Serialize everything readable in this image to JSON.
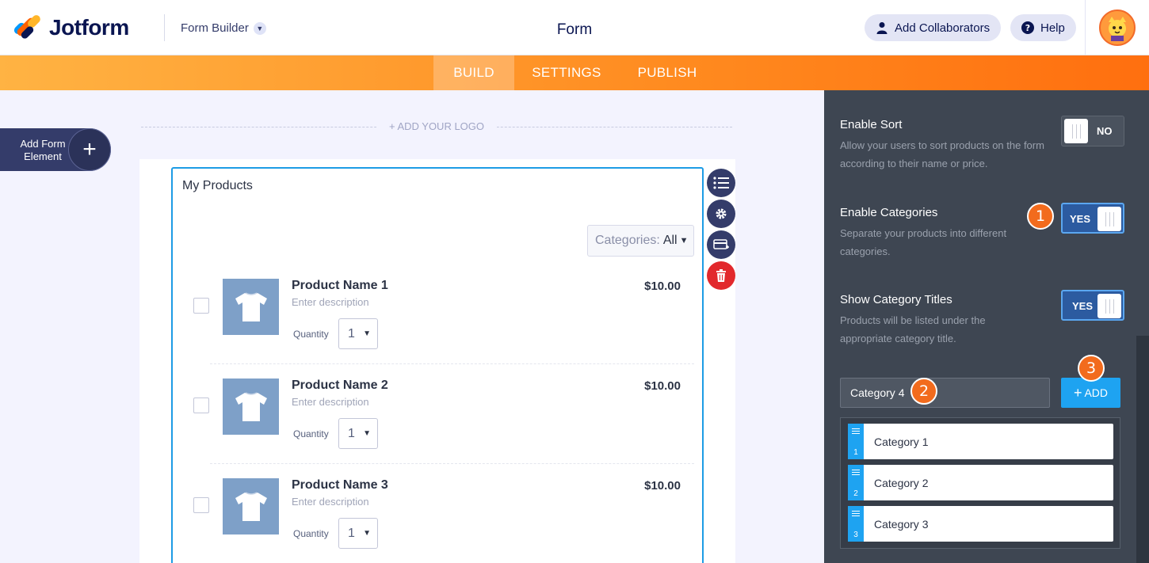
{
  "header": {
    "logo_text": "Jotform",
    "builder_menu": "Form Builder",
    "title": "Form",
    "collab_label": "Add Collaborators",
    "help_label": "Help"
  },
  "tabs": [
    {
      "label": "BUILD",
      "active": true
    },
    {
      "label": "SETTINGS",
      "active": false
    },
    {
      "label": "PUBLISH",
      "active": false
    }
  ],
  "left": {
    "add_element_label": "Add Form Element",
    "add_logo_label": "+ ADD YOUR LOGO"
  },
  "product_list": {
    "title": "My Products",
    "categories_label": "Categories:",
    "categories_value": "All",
    "products": [
      {
        "name": "Product Name 1",
        "description": "Enter description",
        "price": "$10.00",
        "quantity_label": "Quantity",
        "quantity": "1"
      },
      {
        "name": "Product Name 2",
        "description": "Enter description",
        "price": "$10.00",
        "quantity_label": "Quantity",
        "quantity": "1"
      },
      {
        "name": "Product Name 3",
        "description": "Enter description",
        "price": "$10.00",
        "quantity_label": "Quantity",
        "quantity": "1"
      }
    ]
  },
  "panel": {
    "enable_sort": {
      "title": "Enable Sort",
      "description": "Allow your users to sort products on the form according to their name or price.",
      "toggle": "NO"
    },
    "enable_categories": {
      "title": "Enable Categories",
      "description": "Separate your products into different categories.",
      "toggle": "YES"
    },
    "show_category_titles": {
      "title": "Show Category Titles",
      "description": "Products will be listed under the appropriate category title.",
      "toggle": "YES"
    },
    "category_input_value": "Category 4",
    "add_button_label": "ADD",
    "categories": [
      {
        "label": "Category 1",
        "index": "1"
      },
      {
        "label": "Category 2",
        "index": "2"
      },
      {
        "label": "Category 3",
        "index": "3"
      }
    ],
    "badges": [
      "1",
      "2",
      "3"
    ]
  },
  "colors": {
    "accent_orange": "#ff8a1f",
    "brand_navy": "#0a1551",
    "selection_blue": "#1d9ce5",
    "panel_bg": "#3e4652",
    "badge_orange": "#f26b1d"
  }
}
